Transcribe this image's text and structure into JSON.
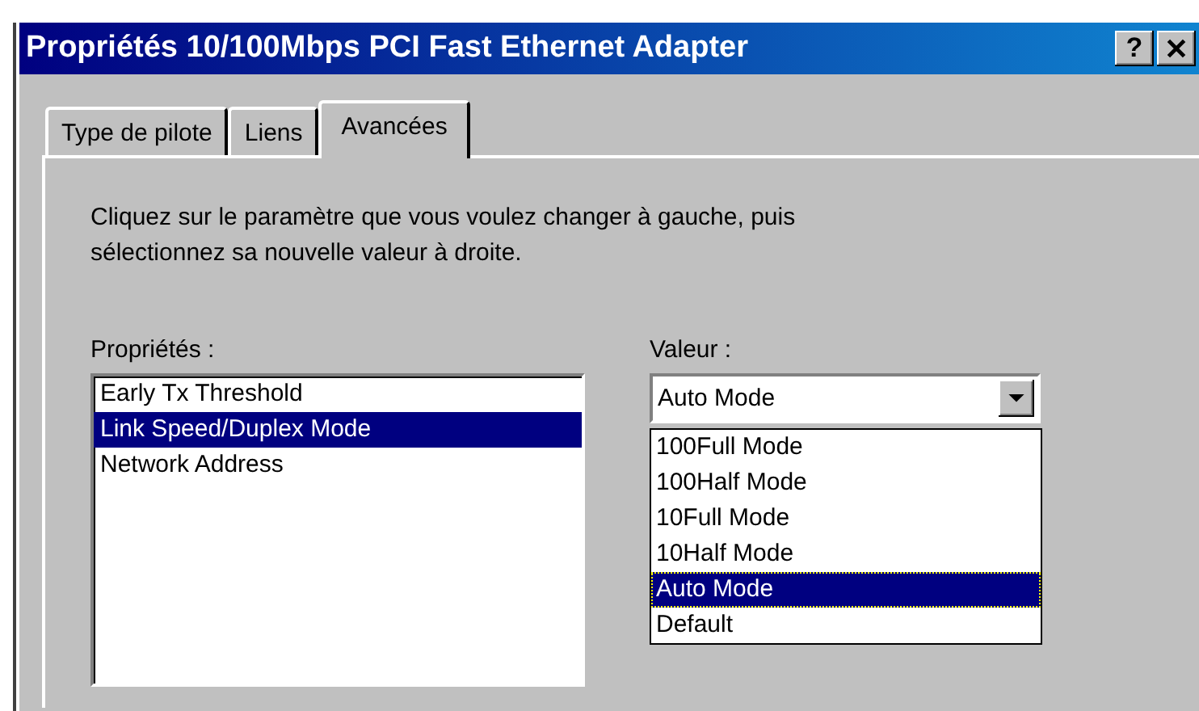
{
  "window": {
    "title": "Propriétés 10/100Mbps PCI Fast Ethernet Adapter",
    "help_button": "?"
  },
  "tabs": [
    {
      "label": "Type de pilote",
      "selected": false
    },
    {
      "label": "Liens",
      "selected": false
    },
    {
      "label": "Avancées",
      "selected": true
    }
  ],
  "instructions": "Cliquez sur le paramètre que vous voulez changer à gauche, puis sélectionnez sa nouvelle valeur à droite.",
  "properties": {
    "label": "Propriétés :",
    "items": [
      {
        "label": "Early Tx Threshold",
        "selected": false
      },
      {
        "label": "Link Speed/Duplex Mode",
        "selected": true
      },
      {
        "label": "Network Address",
        "selected": false
      }
    ]
  },
  "value": {
    "label": "Valeur :",
    "current": "Auto Mode",
    "expanded": true,
    "options": [
      {
        "label": "100Full Mode",
        "selected": false
      },
      {
        "label": "100Half Mode",
        "selected": false
      },
      {
        "label": "10Full Mode",
        "selected": false
      },
      {
        "label": "10Half Mode",
        "selected": false
      },
      {
        "label": "Auto Mode",
        "selected": true
      },
      {
        "label": "Default",
        "selected": false
      }
    ]
  }
}
